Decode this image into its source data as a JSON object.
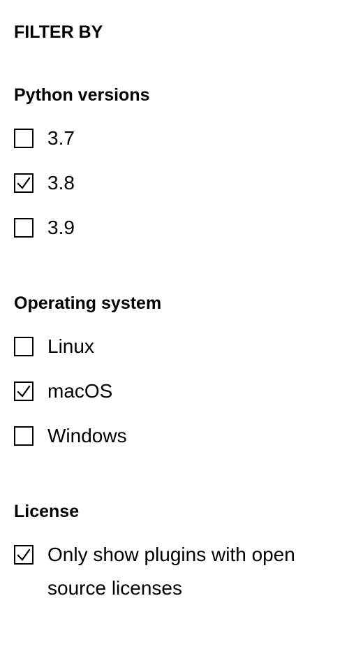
{
  "filter": {
    "title": "FILTER BY",
    "sections": [
      {
        "title": "Python versions",
        "options": [
          {
            "label": "3.7",
            "checked": false
          },
          {
            "label": "3.8",
            "checked": true
          },
          {
            "label": "3.9",
            "checked": false
          }
        ]
      },
      {
        "title": "Operating system",
        "options": [
          {
            "label": "Linux",
            "checked": false
          },
          {
            "label": "macOS",
            "checked": true
          },
          {
            "label": "Windows",
            "checked": false
          }
        ]
      },
      {
        "title": "License",
        "options": [
          {
            "label": "Only show plugins with open source licenses",
            "checked": true
          }
        ]
      }
    ]
  }
}
